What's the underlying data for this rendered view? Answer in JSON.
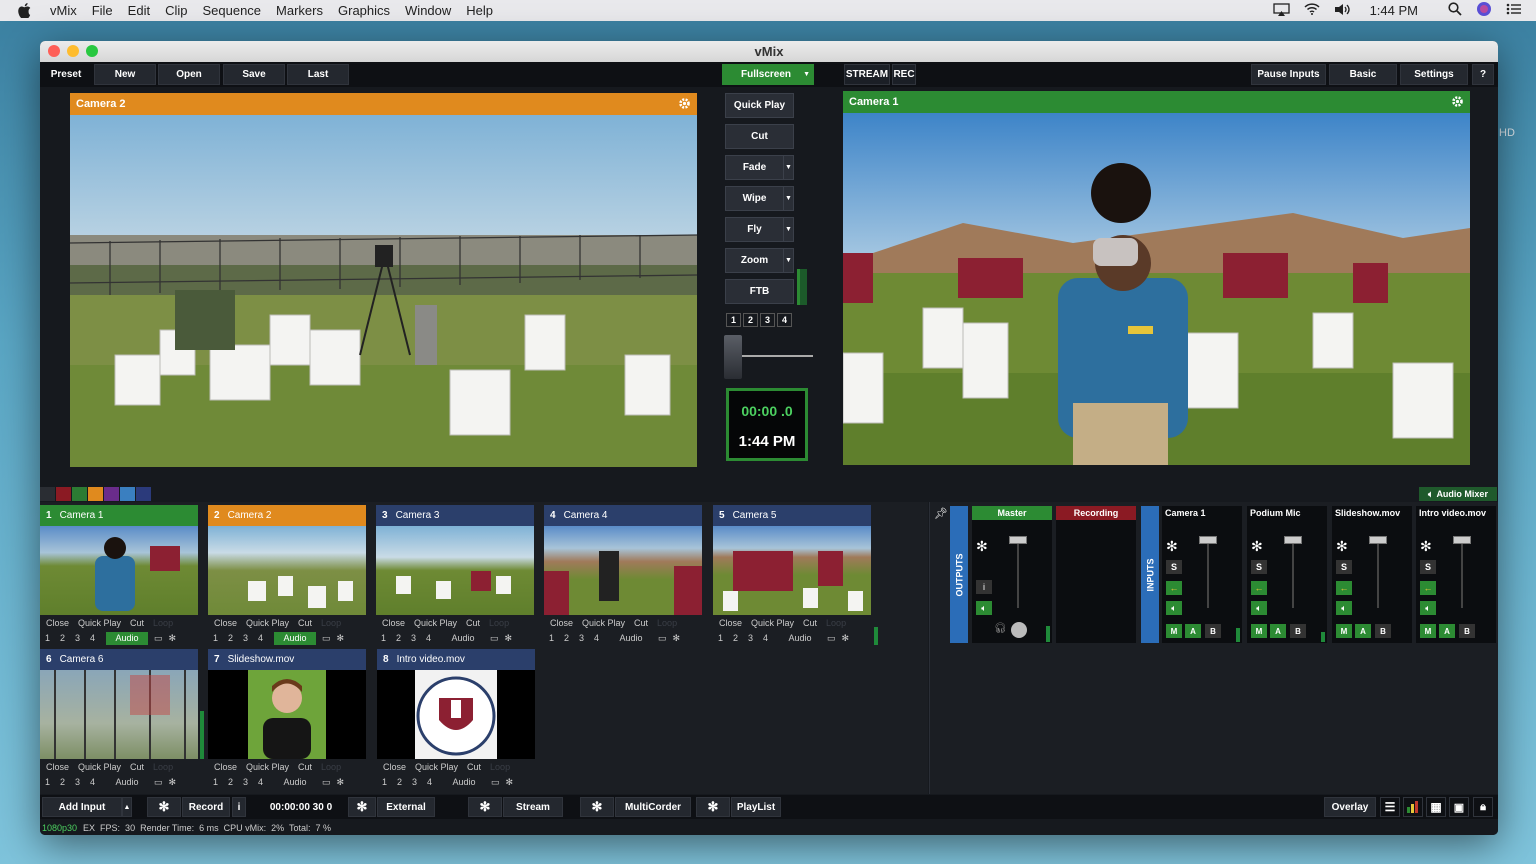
{
  "menubar": {
    "app": "vMix",
    "items": [
      "File",
      "Edit",
      "Clip",
      "Sequence",
      "Markers",
      "Graphics",
      "Window",
      "Help"
    ],
    "time": "1:44 PM"
  },
  "window": {
    "title": "vMix"
  },
  "toolbar": {
    "preset": "Preset",
    "new": "New",
    "open": "Open",
    "save": "Save",
    "last": "Last",
    "fullscreen": "Fullscreen",
    "stream": "STREAM",
    "rec": "REC",
    "pause_inputs": "Pause Inputs",
    "basic": "Basic",
    "settings": "Settings",
    "help": "?"
  },
  "preview": {
    "title": "Camera 2",
    "color": "#e08a1e"
  },
  "output": {
    "title": "Camera 1",
    "color": "#2c8b33"
  },
  "transitions": {
    "quick_play": "Quick Play",
    "cut": "Cut",
    "fade": "Fade",
    "wipe": "Wipe",
    "fly": "Fly",
    "zoom": "Zoom",
    "ftb": "FTB",
    "numbers": [
      "1",
      "2",
      "3",
      "4"
    ]
  },
  "clock": {
    "timecode": "00:00 .0",
    "time": "1:44 PM"
  },
  "audio_mixer_label": "Audio Mixer",
  "inputs": [
    {
      "num": "1",
      "name": "Camera 1",
      "hdr": "#2c8b33",
      "close": "Close",
      "qp": "Quick Play",
      "cut": "Cut",
      "loop": "Loop",
      "audio": "Audio",
      "audio_on": true
    },
    {
      "num": "2",
      "name": "Camera 2",
      "hdr": "#e08a1e",
      "close": "Close",
      "qp": "Quick Play",
      "cut": "Cut",
      "loop": "Loop",
      "audio": "Audio",
      "audio_on": true
    },
    {
      "num": "3",
      "name": "Camera 3",
      "hdr": "#2b3f6b",
      "close": "Close",
      "qp": "Quick Play",
      "cut": "Cut",
      "loop": "Loop",
      "audio": "Audio",
      "audio_on": false
    },
    {
      "num": "4",
      "name": "Camera 4",
      "hdr": "#2b3f6b",
      "close": "Close",
      "qp": "Quick Play",
      "cut": "Cut",
      "loop": "Loop",
      "audio": "Audio",
      "audio_on": false
    },
    {
      "num": "5",
      "name": "Camera 5",
      "hdr": "#2b3f6b",
      "close": "Close",
      "qp": "Quick Play",
      "cut": "Cut",
      "loop": "Loop",
      "audio": "Audio",
      "audio_on": false
    },
    {
      "num": "6",
      "name": "Camera 6",
      "hdr": "#2b3f6b",
      "close": "Close",
      "qp": "Quick Play",
      "cut": "Cut",
      "loop": "Loop",
      "audio": "Audio",
      "audio_on": false
    },
    {
      "num": "7",
      "name": "Slideshow.mov",
      "hdr": "#2b3f6b",
      "close": "Close",
      "qp": "Quick Play",
      "cut": "Cut",
      "loop": "Loop",
      "audio": "Audio",
      "audio_on": false
    },
    {
      "num": "8",
      "name": "Intro video.mov",
      "hdr": "#2b3f6b",
      "close": "Close",
      "qp": "Quick Play",
      "cut": "Cut",
      "loop": "Loop",
      "audio": "Audio",
      "audio_on": false
    }
  ],
  "tile_numbers": [
    "1",
    "2",
    "3",
    "4"
  ],
  "mixer": {
    "outputs_label": "OUTPUTS",
    "inputs_label": "INPUTS",
    "master": "Master",
    "recording": "Recording",
    "channels": [
      "Camera  1",
      "Podium Mic",
      "Slideshow.mov",
      "Intro video.mov"
    ],
    "m": "M",
    "a": "A",
    "b": "B",
    "s": "S",
    "i": "i"
  },
  "bottombar": {
    "add_input": "Add Input",
    "record": "Record",
    "i": "i",
    "rec_time": "00:00:00 30 0",
    "external": "External",
    "stream": "Stream",
    "multicorder": "MultiCorder",
    "playlist": "PlayList",
    "overlay": "Overlay"
  },
  "status": {
    "format": "1080p30",
    "rest": "EX  FPS:  30  Render Time:  6 ms  CPU vMix:  2%  Total:  7 %"
  },
  "side_hd": "HD"
}
